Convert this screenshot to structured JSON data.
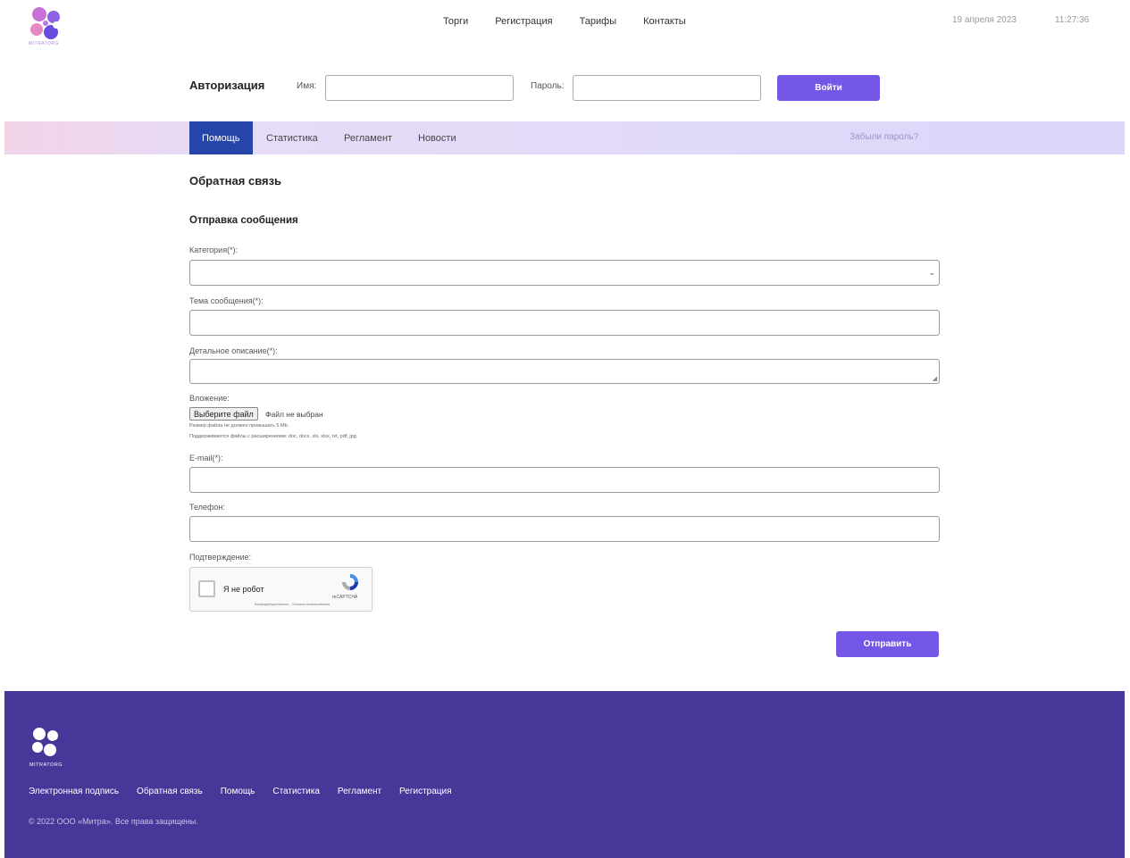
{
  "header": {
    "logo_text": "MITRATORG",
    "nav": [
      "Торги",
      "Регистрация",
      "Тарифы",
      "Контакты"
    ],
    "date": "19 апреля 2023",
    "time": "11:27:36"
  },
  "auth": {
    "title": "Авторизация",
    "name_label": "Имя:",
    "name_value": "",
    "password_label": "Пароль:",
    "password_value": "",
    "login_button": "Войти"
  },
  "tabs": [
    {
      "label": "Помощь",
      "active": true
    },
    {
      "label": "Статистика",
      "active": false
    },
    {
      "label": "Регламент",
      "active": false
    },
    {
      "label": "Новости",
      "active": false
    }
  ],
  "forgot_password": "Забыли пароль?",
  "page": {
    "title": "Обратная связь",
    "subtitle": "Отправка сообщения"
  },
  "form": {
    "category_label": "Категория(*):",
    "category_value": "",
    "subject_label": "Тема сообщения(*):",
    "subject_value": "",
    "description_label": "Детальное описание(*):",
    "description_value": "",
    "attachment_label": "Вложение:",
    "file_button": "Выберите файл",
    "file_status": "Файл не выбран",
    "file_hint_size": "Размер файла не должен превышать 5 Mb.",
    "file_hint_types": "Поддерживаются файлы с расширениями: doc, docx, xls, xlsx, txt, pdf, jpg.",
    "email_label": "E-mail(*):",
    "email_value": "",
    "phone_label": "Телефон:",
    "phone_value": "",
    "confirm_label": "Подтверждение:",
    "captcha_label": "Я не робот",
    "captcha_brand": "reCAPTCHA",
    "captcha_terms": "Конфиденциальность - Условия использования",
    "submit_button": "Отправить"
  },
  "footer": {
    "logo_text": "MITRATORG",
    "links": [
      "Электронная подпись",
      "Обратная связь",
      "Помощь",
      "Статистика",
      "Регламент",
      "Регистрация"
    ],
    "copyright": "© 2022 ООО «Митра». Все права защищены."
  },
  "colors": {
    "accent": "#7557e8",
    "tab_active": "#2545a8",
    "footer_bg": "#483699"
  }
}
